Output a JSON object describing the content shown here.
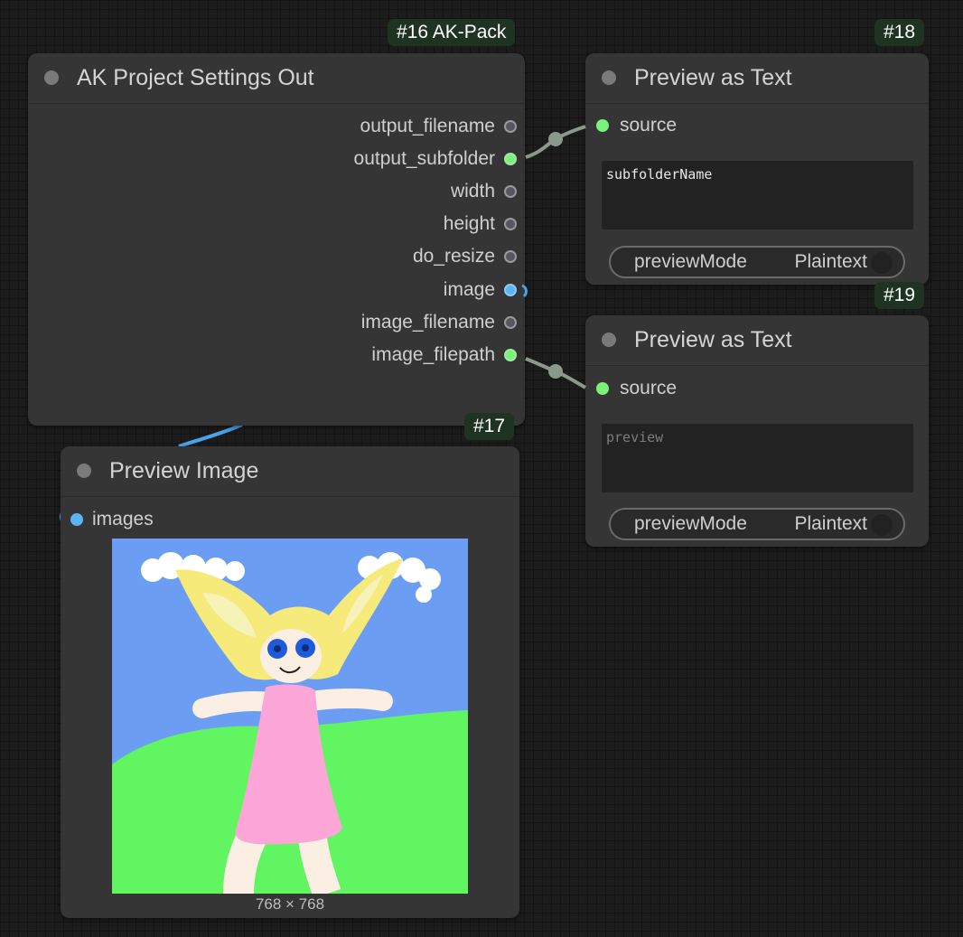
{
  "nodes": {
    "settings": {
      "badge": "#16 AK-Pack",
      "title": "AK Project Settings Out",
      "outputs": [
        "output_filename",
        "output_subfolder",
        "width",
        "height",
        "do_resize",
        "image",
        "image_filename",
        "image_filepath"
      ]
    },
    "preview18": {
      "badge": "#18",
      "title": "Preview as Text",
      "input": "source",
      "text": "subfolderName",
      "toggle_label": "previewMode",
      "toggle_value": "Plaintext"
    },
    "preview19": {
      "badge": "#19",
      "title": "Preview as Text",
      "input": "source",
      "placeholder": "preview",
      "toggle_label": "previewMode",
      "toggle_value": "Plaintext"
    },
    "preview_image": {
      "badge": "#17",
      "title": "Preview Image",
      "input": "images",
      "caption": "768 × 768"
    }
  },
  "colors": {
    "canvas": "#1c1c1c",
    "node_body": "#353535",
    "badge_bg": "#1f3322",
    "slot_string": "#7af27a",
    "slot_image": "#5db4f2",
    "wire_string": "#8a9a8a",
    "wire_image": "#4aa3e8"
  }
}
